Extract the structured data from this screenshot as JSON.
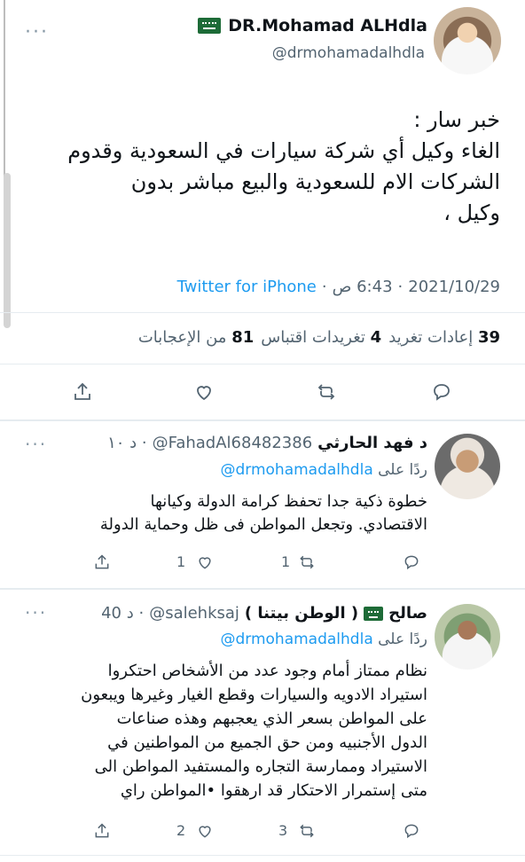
{
  "main_tweet": {
    "author_name": "DR.Mohamad ALHdla",
    "author_handle": "@drmohamadalhdla",
    "text_line1": "خبر سار :",
    "text_line2": "الغاء وكيل أي شركة سيارات في السعودية وقدوم",
    "text_line3": "الشركات الام للسعودية والبيع مباشر بدون",
    "text_line4": "وكيل ،",
    "date": "2021/10/29",
    "time": "6:43 ص",
    "separator": "·",
    "source": "Twitter for iPhone",
    "more": "···",
    "stats": {
      "retweets_count": "39",
      "retweets_label": "إعادات تغريد",
      "quotes_count": "4",
      "quotes_label": "تغريدات اقتباس",
      "likes_count": "81",
      "likes_label": "من الإعجابات"
    }
  },
  "replies": [
    {
      "name": "د فهد الحارثي",
      "handle": "@FahadAl68482386",
      "time": "د ١٠ ·",
      "replying_prefix": "ردًا على",
      "replying_to": "@drmohamadalhdla",
      "line1": "خطوة ذكية جدا تحفظ كرامة الدولة وكيانها",
      "line2": "الاقتصادي.  وتجعل المواطن فى ظل وحماية الدولة",
      "likes": "1",
      "retweets": "1",
      "more": "···"
    },
    {
      "name": "صالح",
      "name_suffix": "( الوطن بيتنا )",
      "handle": "@salehksaj",
      "time": "40 د ·",
      "replying_prefix": "ردًا على",
      "replying_to": "@drmohamadalhdla",
      "line1": "نظام ممتاز  أمام وجود عدد من الأشخاص احتكروا",
      "line2": "استيراد الادويه والسيارات وقطع الغيار وغيرها ويبعون",
      "line3": "على المواطن بسعر الذي يعجبهم وهذه صناعات",
      "line4": "الدول الأجنبيه ومن حق الجميع من المواطنين في",
      "line5": "الاستيراد وممارسة التجاره والمستفيد المواطن الى",
      "line6": "متى إستمرار الاحتكار قد ارهقوا •المواطن   راي",
      "likes": "2",
      "retweets": "3",
      "more": "···"
    }
  ],
  "icons": [
    "share-icon",
    "like-icon",
    "retweet-icon",
    "reply-icon",
    "saudi-flag-icon"
  ],
  "colors": {
    "link": "#1d9bf0",
    "muted": "#536471",
    "text": "#0f1419",
    "flag": "#1d6b37"
  }
}
